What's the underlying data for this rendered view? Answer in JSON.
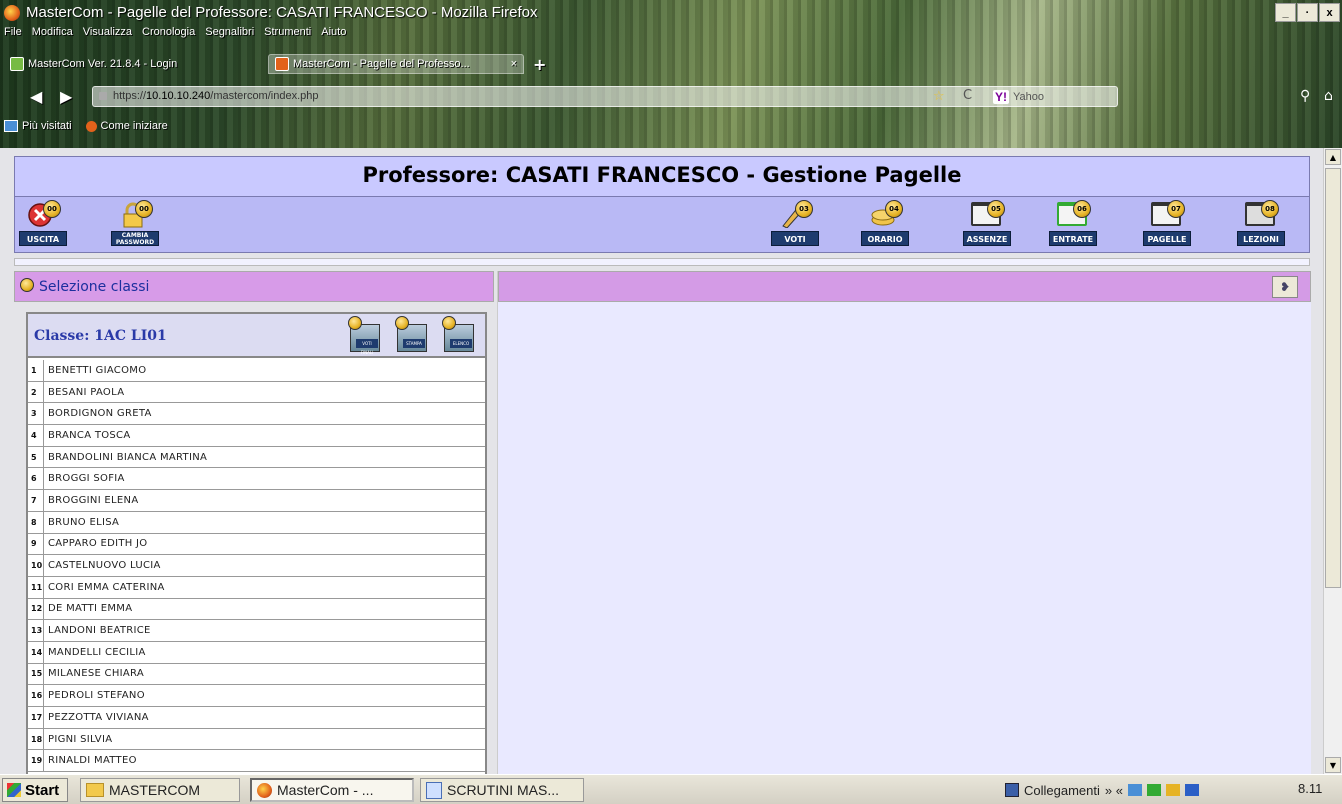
{
  "window": {
    "title": "MasterCom - Pagelle del Professore: CASATI FRANCESCO - Mozilla Firefox",
    "buttons": [
      "_",
      "·",
      "x"
    ]
  },
  "menu": [
    "File",
    "Modifica",
    "Visualizza",
    "Cronologia",
    "Segnalibri",
    "Strumenti",
    "Aiuto"
  ],
  "tabs": [
    {
      "label": "MasterCom Ver. 21.8.4 - Login",
      "active": false
    },
    {
      "label": "MasterCom - Pagelle del Professo...",
      "active": true
    }
  ],
  "navigation": {
    "url_prefix": "https://",
    "url_host": "10.10.10.240",
    "url_path": "/mastercom/index.php",
    "search_placeholder": "Yahoo",
    "search_engine": "Y!"
  },
  "bookmarks": [
    "Più visitati",
    "Come iniziare"
  ],
  "page": {
    "title": "Professore: CASATI FRANCESCO - Gestione Pagelle",
    "toolbar_left": [
      {
        "badge": "00",
        "label": "USCITA",
        "icon": "close-icon"
      },
      {
        "badge": "00",
        "label": "CAMBIA PASSWORD",
        "icon": "lock-icon"
      }
    ],
    "toolbar_right": [
      {
        "badge": "03",
        "label": "VOTI",
        "icon": "pencil-icon"
      },
      {
        "badge": "04",
        "label": "ORARIO",
        "icon": "coins-icon"
      },
      {
        "badge": "05",
        "label": "ASSENZE",
        "icon": "register-icon"
      },
      {
        "badge": "06",
        "label": "ENTRATE",
        "icon": "entry-icon"
      },
      {
        "badge": "07",
        "label": "PAGELLE",
        "icon": "report-icon"
      },
      {
        "badge": "08",
        "label": "LEZIONI",
        "icon": "lesson-icon"
      }
    ],
    "selection_title": "Selezione classi",
    "class_title": "Classe: 1AC LI01",
    "class_buttons": [
      {
        "label": "VOTI FINALI",
        "icon": "keys-icon"
      },
      {
        "label": "STAMPA",
        "icon": "print-icon"
      },
      {
        "label": "ELENCO",
        "icon": "list-icon"
      }
    ],
    "students": [
      {
        "num": "1",
        "name": "BENETTI GIACOMO"
      },
      {
        "num": "2",
        "name": "BESANI PAOLA"
      },
      {
        "num": "3",
        "name": "BORDIGNON GRETA"
      },
      {
        "num": "4",
        "name": "BRANCA TOSCA"
      },
      {
        "num": "5",
        "name": "BRANDOLINI BIANCA MARTINA"
      },
      {
        "num": "6",
        "name": "BROGGI SOFIA"
      },
      {
        "num": "7",
        "name": "BROGGINI ELENA"
      },
      {
        "num": "8",
        "name": "BRUNO ELISA"
      },
      {
        "num": "9",
        "name": "CAPPARO EDITH JO"
      },
      {
        "num": "10",
        "name": "CASTELNUOVO LUCIA"
      },
      {
        "num": "11",
        "name": "CORI EMMA CATERINA"
      },
      {
        "num": "12",
        "name": "DE MATTI EMMA"
      },
      {
        "num": "13",
        "name": "LANDONI BEATRICE"
      },
      {
        "num": "14",
        "name": "MANDELLI CECILIA"
      },
      {
        "num": "15",
        "name": "MILANESE CHIARA"
      },
      {
        "num": "16",
        "name": "PEDROLI STEFANO"
      },
      {
        "num": "17",
        "name": "PEZZOTTA VIVIANA"
      },
      {
        "num": "18",
        "name": "PIGNI SILVIA"
      },
      {
        "num": "19",
        "name": "RINALDI MATTEO"
      }
    ]
  },
  "taskbar": {
    "start": "Start",
    "items": [
      {
        "label": "MASTERCOM",
        "icon": "folder-icon",
        "active": false
      },
      {
        "label": "MasterCom - ...",
        "icon": "firefox-icon",
        "active": true
      },
      {
        "label": "SCRUTINI MAS...",
        "icon": "document-icon",
        "active": false
      }
    ],
    "tray_label": "Collegamenti",
    "clock": "8.11"
  }
}
